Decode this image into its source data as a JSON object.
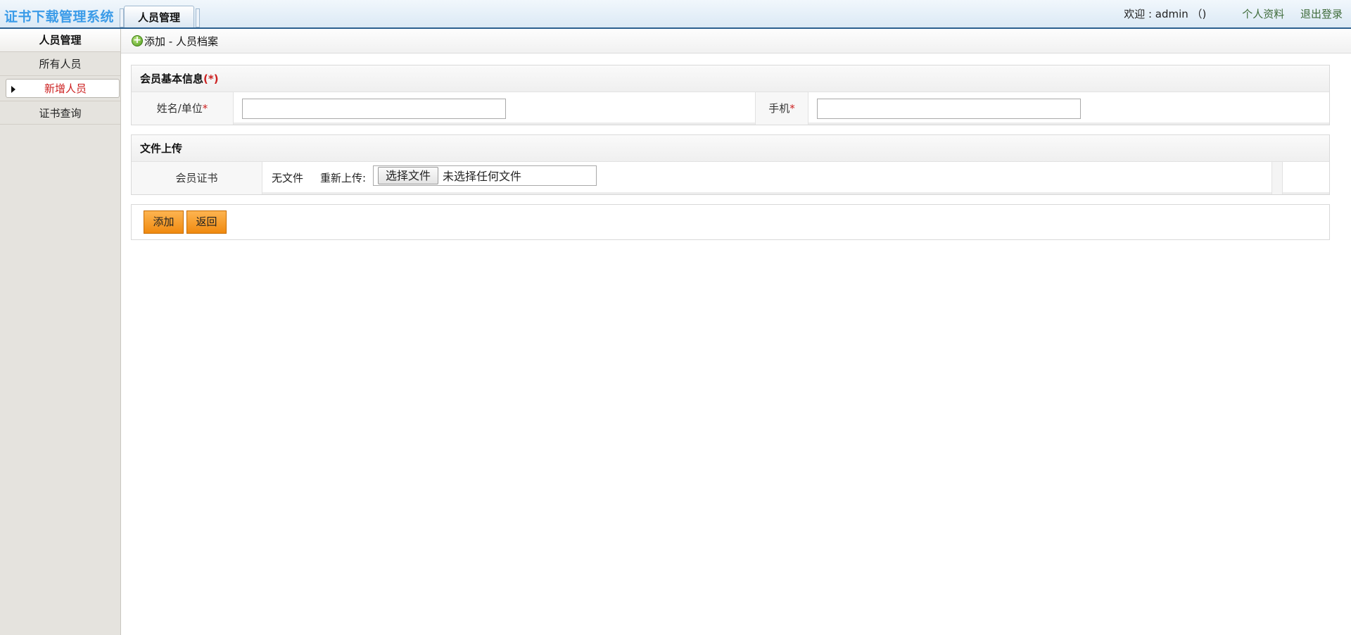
{
  "header": {
    "app_title": "证书下载管理系统",
    "tab_label": "人员管理",
    "welcome": "欢迎 : admin （)",
    "profile_link": "个人资料",
    "logout_link": "退出登录"
  },
  "sidebar": {
    "heading": "人员管理",
    "items": [
      {
        "label": "所有人员",
        "active": false
      },
      {
        "label": "新增人员",
        "active": true
      },
      {
        "label": "证书查询",
        "active": false
      }
    ]
  },
  "page": {
    "icon": "add-circle-icon",
    "title": "添加 - 人员档案"
  },
  "basic_info": {
    "heading": "会员基本信息",
    "heading_required": "(*)",
    "name_label": "姓名/单位",
    "name_value": "",
    "phone_label": "手机",
    "phone_value": "",
    "required_mark": "*"
  },
  "upload": {
    "heading": "文件上传",
    "certificate_label": "会员证书",
    "current_file": "无文件",
    "reupload_label": "重新上传:",
    "choose_button": "选择文件",
    "no_file_text": "未选择任何文件"
  },
  "actions": {
    "add_button": "添加",
    "back_button": "返回"
  },
  "colors": {
    "title_blue": "#3a9be8",
    "required_red": "#cc1f1f",
    "button_orange": "#f08a10"
  }
}
